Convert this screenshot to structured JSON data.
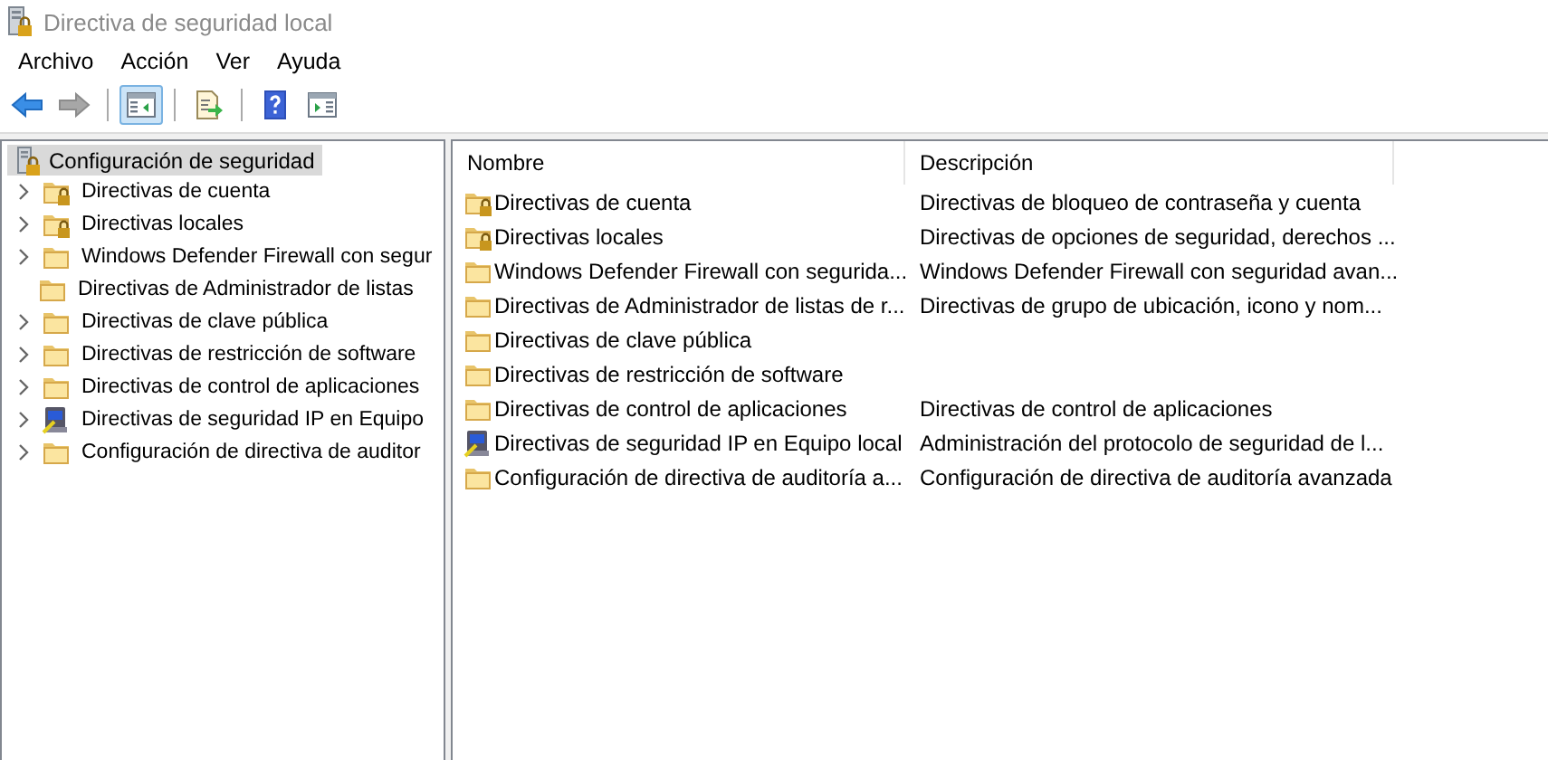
{
  "window": {
    "title": "Directiva de seguridad local"
  },
  "menu": [
    "Archivo",
    "Acción",
    "Ver",
    "Ayuda"
  ],
  "toolbar": [
    {
      "kind": "back",
      "pressed": false,
      "disabled": false
    },
    {
      "kind": "forward",
      "pressed": false,
      "disabled": true
    },
    {
      "kind": "sep"
    },
    {
      "kind": "tree",
      "pressed": true,
      "disabled": false
    },
    {
      "kind": "sep"
    },
    {
      "kind": "export",
      "pressed": false,
      "disabled": false
    },
    {
      "kind": "sep"
    },
    {
      "kind": "help",
      "pressed": false,
      "disabled": false
    },
    {
      "kind": "actions",
      "pressed": false,
      "disabled": false
    }
  ],
  "tree": {
    "label": "Configuración de seguridad",
    "selected": true,
    "children": [
      {
        "label": "Directivas de cuenta",
        "kind": "lockfolder",
        "expandable": true,
        "selected": false
      },
      {
        "label": "Directivas locales",
        "kind": "lockfolder",
        "expandable": true,
        "selected": false
      },
      {
        "label": "Windows Defender Firewall con segur",
        "kind": "folder",
        "expandable": true,
        "selected": false
      },
      {
        "label": "Directivas de Administrador de listas",
        "kind": "folder",
        "expandable": false,
        "selected": false
      },
      {
        "label": "Directivas de clave pública",
        "kind": "folder",
        "expandable": true,
        "selected": false
      },
      {
        "label": "Directivas de restricción de software",
        "kind": "folder",
        "expandable": true,
        "selected": false
      },
      {
        "label": "Directivas de control de aplicaciones",
        "kind": "folder",
        "expandable": true,
        "selected": false
      },
      {
        "label": "Directivas de seguridad IP en Equipo",
        "kind": "ipsec",
        "expandable": true,
        "selected": false
      },
      {
        "label": "Configuración de directiva de auditor",
        "kind": "folder",
        "expandable": true,
        "selected": false
      }
    ]
  },
  "table": {
    "columns": [
      "Nombre",
      "Descripción"
    ],
    "rows": [
      {
        "name": "Directivas de cuenta",
        "description": "Directivas de bloqueo de contraseña y cuenta",
        "kind": "lockfolder"
      },
      {
        "name": "Directivas locales",
        "description": "Directivas de opciones de seguridad, derechos ...",
        "kind": "lockfolder"
      },
      {
        "name": "Windows Defender Firewall con segurida...",
        "description": "Windows Defender Firewall con seguridad avan...",
        "kind": "folder"
      },
      {
        "name": "Directivas de Administrador de listas de r...",
        "description": "Directivas de grupo de ubicación, icono y nom...",
        "kind": "folder"
      },
      {
        "name": "Directivas de clave pública",
        "kind": "folder"
      },
      {
        "name": "Directivas de restricción de software",
        "kind": "folder"
      },
      {
        "name": "Directivas de control de aplicaciones",
        "description": "Directivas de control de aplicaciones",
        "kind": "folder"
      },
      {
        "name": "Directivas de seguridad IP en Equipo local",
        "description": "Administración del protocolo de seguridad de l...",
        "kind": "ipsec"
      },
      {
        "name": "Configuración de directiva de auditoría a...",
        "description": "Configuración de directiva de auditoría avanzada",
        "kind": "folder"
      }
    ]
  }
}
